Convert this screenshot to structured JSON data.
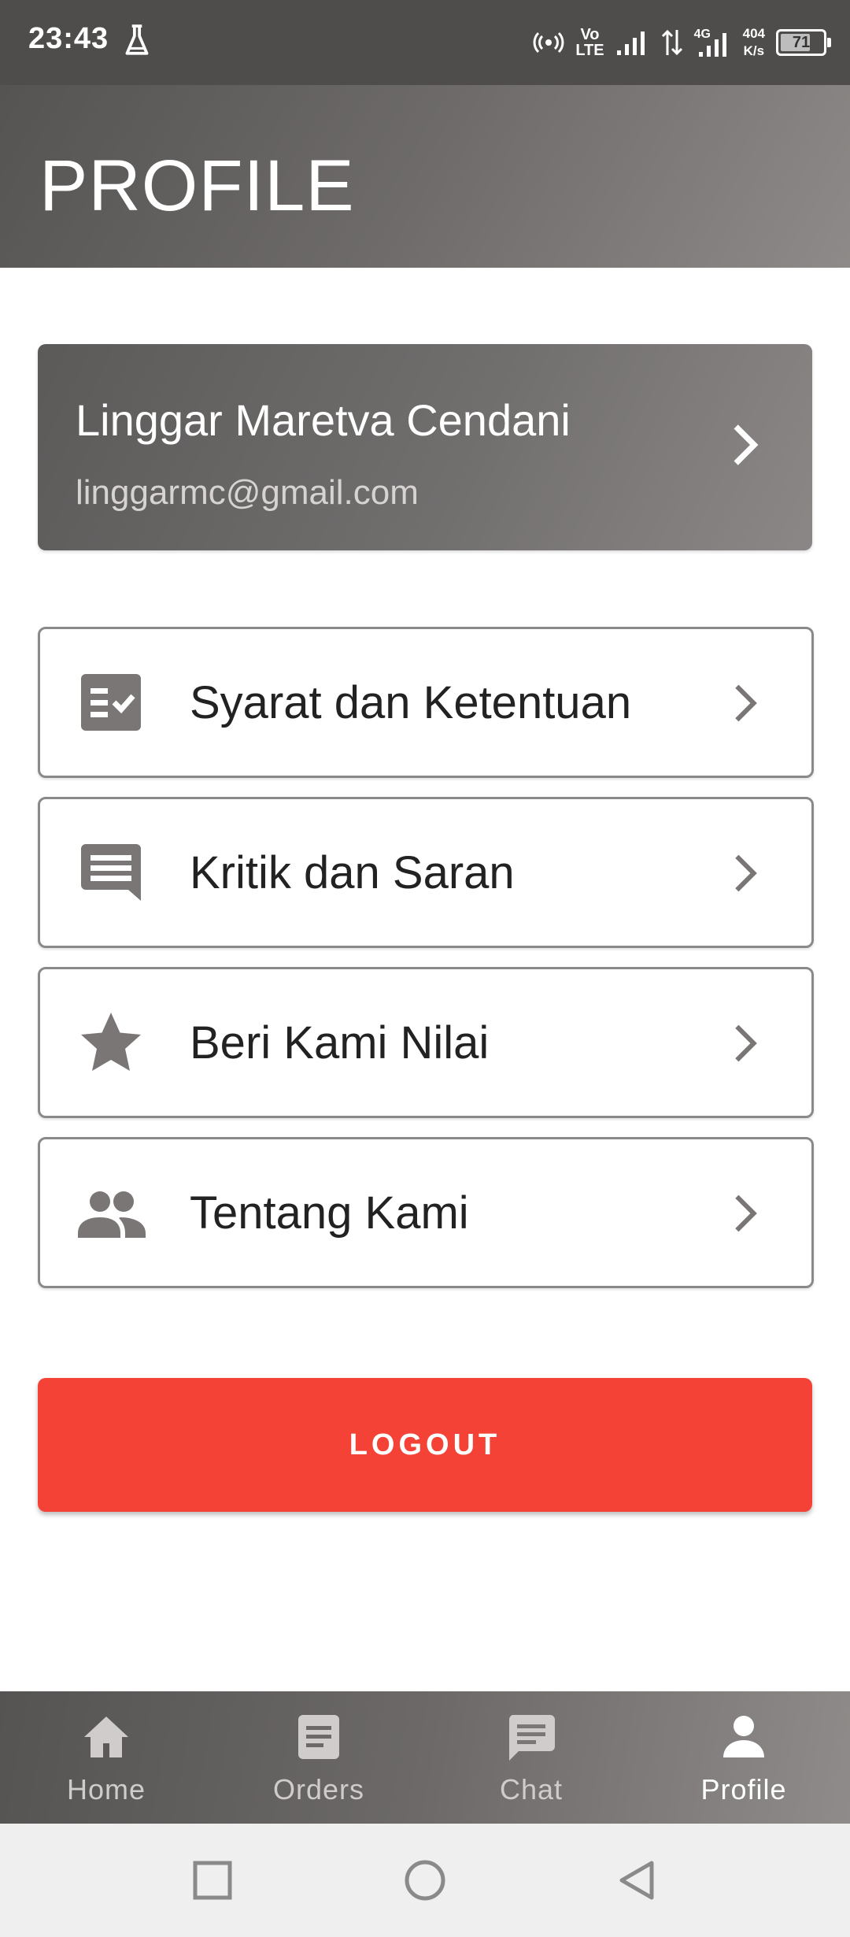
{
  "status_bar": {
    "time": "23:43",
    "volte_top": "Vo",
    "volte_bottom": "LTE",
    "network": "4G",
    "speed_value": "404",
    "speed_unit": "K/s",
    "battery": "71",
    "battery_level_percent": 71
  },
  "header": {
    "title": "PROFILE"
  },
  "profile": {
    "name": "Linggar Maretva Cendani",
    "email": "linggarmc@gmail.com"
  },
  "menu": [
    {
      "label": "Syarat dan Ketentuan",
      "icon": "checklist-icon"
    },
    {
      "label": "Kritik dan Saran",
      "icon": "message-icon"
    },
    {
      "label": "Beri Kami Nilai",
      "icon": "star-icon"
    },
    {
      "label": "Tentang Kami",
      "icon": "people-icon"
    }
  ],
  "logout": {
    "label": "LOGOUT"
  },
  "bottom_nav": [
    {
      "label": "Home",
      "icon": "home-icon",
      "active": false
    },
    {
      "label": "Orders",
      "icon": "document-icon",
      "active": false
    },
    {
      "label": "Chat",
      "icon": "chat-icon",
      "active": false
    },
    {
      "label": "Profile",
      "icon": "person-icon",
      "active": true
    }
  ],
  "colors": {
    "accent": "#f44336",
    "header_gray": "#6e6b6a",
    "icon_gray": "#7a7676"
  }
}
